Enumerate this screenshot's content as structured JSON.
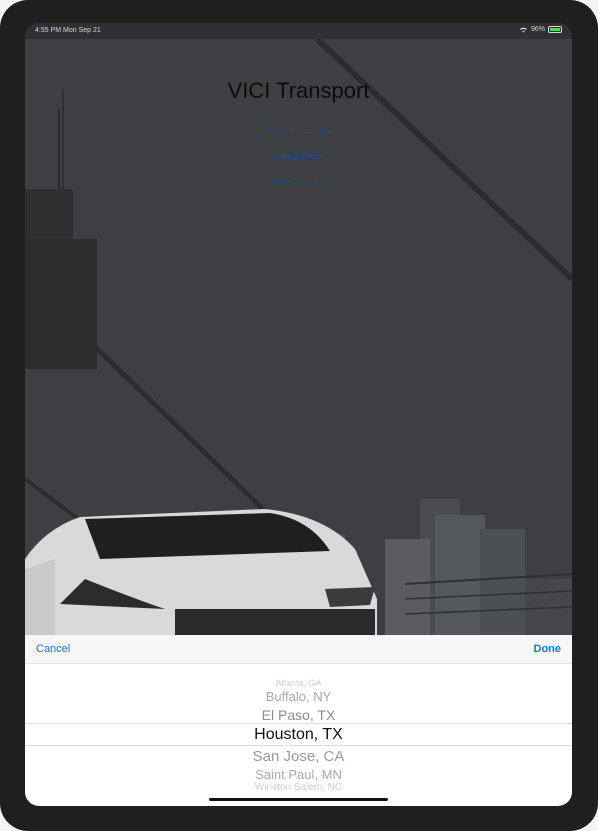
{
  "status_bar": {
    "time": "4:55 PM  Mon Sep 21",
    "battery": "96%"
  },
  "app": {
    "title": "VICI Transport",
    "links": [
      "Select Location",
      "Select Price",
      "Select Dates"
    ]
  },
  "picker": {
    "cancel_label": "Cancel",
    "done_label": "Done",
    "options": [
      "Atlanta, GA",
      "Buffalo, NY",
      "El Paso, TX",
      "Houston, TX",
      "San Jose, CA",
      "Saint Paul, MN",
      "Winston Salem, NC"
    ],
    "selected": "Houston, TX"
  },
  "colors": {
    "accent": "#1a74e8",
    "link": "#1c4f8f",
    "overlay": "#3d3f42"
  }
}
